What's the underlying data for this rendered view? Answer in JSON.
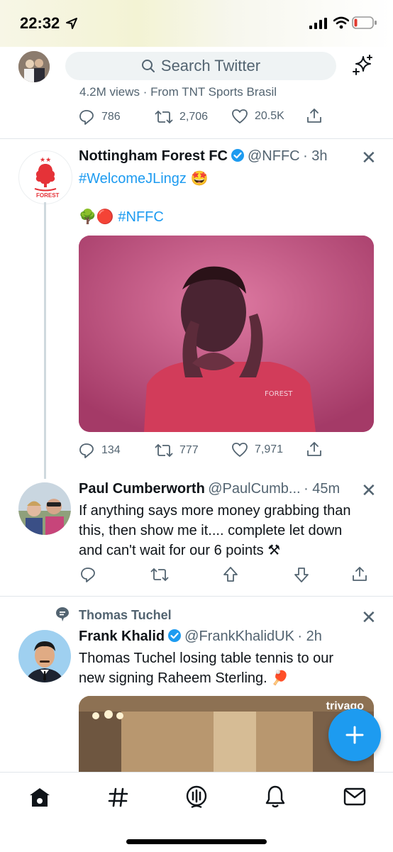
{
  "status_bar": {
    "time": "22:32"
  },
  "header": {
    "search_placeholder": "Search Twitter"
  },
  "prev_tweet": {
    "views_line": "4.2M views · From TNT Sports Brasil",
    "replies": "786",
    "retweets": "2,706",
    "likes": "20.5K"
  },
  "tweet1": {
    "name": "Nottingham Forest FC",
    "handle": "@NFFC",
    "time": "· 3h",
    "hashtag": "#WelcomeJLingz",
    "emoji_line_icons": "🌳🔴",
    "hashtag2": "#NFFC",
    "replies": "134",
    "retweets": "777",
    "likes": "7,971",
    "avatar_text": "FOREST"
  },
  "tweet2": {
    "name": "Paul Cumberworth",
    "handle": "@PaulCumb...",
    "time": "· 45m",
    "text_line1": "If anything says more money grabbing than",
    "text_line2": "this, then show me it.... complete let down",
    "text_line3": "and can't wait for our 6 points ⚒"
  },
  "tweet3": {
    "context": "Thomas Tuchel",
    "name": "Frank Khalid",
    "handle": "@FrankKhalidUK",
    "time": "· 2h",
    "text_line1": "Thomas Tuchel losing table tennis to our",
    "text_line2": "new signing Raheem Sterling. 🏓",
    "media_watermark": "trivago"
  },
  "colors": {
    "accent": "#1d9bf0",
    "muted": "#536471",
    "text": "#0f1419"
  },
  "icons": {
    "tabbar": [
      "home-icon",
      "explore-hashtag-icon",
      "spaces-icon",
      "notifications-icon",
      "messages-icon"
    ]
  }
}
